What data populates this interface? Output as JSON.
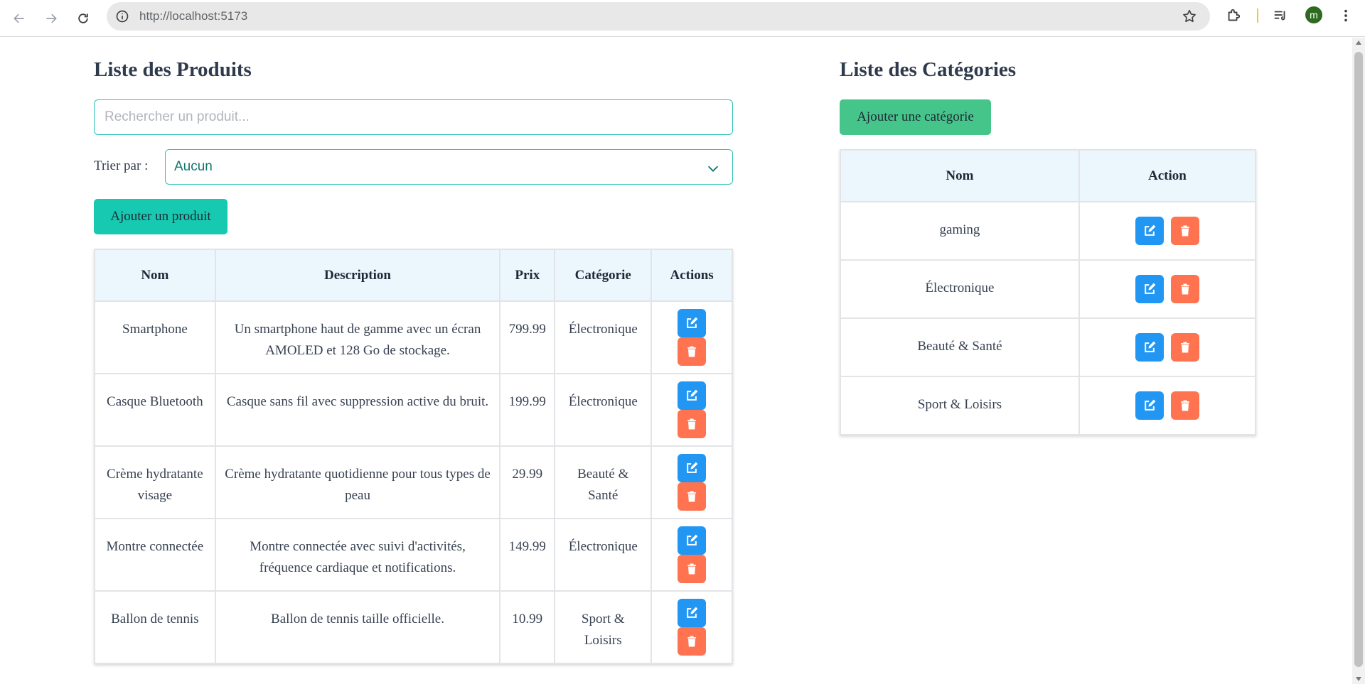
{
  "browser": {
    "url": "http://localhost:5173",
    "avatar_letter": "m"
  },
  "products": {
    "title": "Liste des Produits",
    "search_placeholder": "Rechercher un produit...",
    "sort_label": "Trier par :",
    "sort_value": "Aucun",
    "add_button": "Ajouter un produit",
    "columns": [
      "Nom",
      "Description",
      "Prix",
      "Catégorie",
      "Actions"
    ],
    "rows": [
      {
        "name": "Smartphone",
        "description": "Un smartphone haut de gamme avec un écran AMOLED et 128 Go de stockage.",
        "price": "799.99",
        "category": "Électronique"
      },
      {
        "name": "Casque Bluetooth",
        "description": "Casque sans fil avec suppression active du bruit.",
        "price": "199.99",
        "category": "Électronique"
      },
      {
        "name": "Crème hydratante visage",
        "description": "Crème hydratante quotidienne pour tous types de peau",
        "price": "29.99",
        "category": "Beauté & Santé"
      },
      {
        "name": "Montre connectée",
        "description": "Montre connectée avec suivi d'activités, fréquence cardiaque et notifications.",
        "price": "149.99",
        "category": "Électronique"
      },
      {
        "name": "Ballon de tennis",
        "description": "Ballon de tennis taille officielle.",
        "price": "10.99",
        "category": "Sport & Loisirs"
      }
    ]
  },
  "categories": {
    "title": "Liste des Catégories",
    "add_button": "Ajouter une catégorie",
    "columns": [
      "Nom",
      "Action"
    ],
    "rows": [
      {
        "name": "gaming"
      },
      {
        "name": "Électronique"
      },
      {
        "name": "Beauté & Santé"
      },
      {
        "name": "Sport & Loisirs"
      }
    ]
  },
  "colors": {
    "accent_teal": "#17c9b0",
    "accent_green": "#45c589",
    "edit_blue": "#2196f3",
    "delete_orange": "#ff7350",
    "header_bg": "#ecf6fd"
  },
  "icons": {
    "edit": "edit-icon",
    "delete": "trash-icon"
  }
}
